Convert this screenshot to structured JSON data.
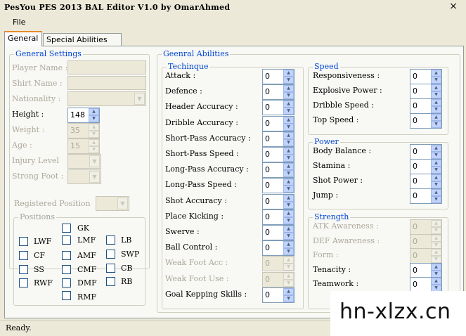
{
  "window": {
    "title": "PesYou PES 2013 BAL Editor V1.0 by OmarAhmed",
    "close_glyph": "×"
  },
  "menu": {
    "file": "File"
  },
  "tabs": [
    {
      "label": "General"
    },
    {
      "label": "Special Abilities"
    }
  ],
  "general_settings": {
    "legend": "General Settings",
    "player_name": {
      "label": "Player Name :",
      "value": ""
    },
    "shirt_name": {
      "label": "Shirt Name :",
      "value": ""
    },
    "nationality": {
      "label": "Nationality :",
      "value": ""
    },
    "height": {
      "label": "Height :",
      "value": "148"
    },
    "weight": {
      "label": "Weight :",
      "value": "35"
    },
    "age": {
      "label": "Age :",
      "value": "15"
    },
    "injury_level": {
      "label": "Injury Level",
      "value": ""
    },
    "strong_foot": {
      "label": "Strong Foot :",
      "value": ""
    },
    "registered_position": {
      "label": "Registered Position",
      "value": ""
    }
  },
  "positions": {
    "legend": "Positions",
    "items": [
      "GK",
      "LWF",
      "LMF",
      "LB",
      "CF",
      "AMF",
      "SWP",
      "SS",
      "CMF",
      "CB",
      "RWF",
      "DMF",
      "RB",
      "RMF"
    ]
  },
  "general_abilities": {
    "legend": "Geenral Abilities"
  },
  "technique": {
    "legend": "Techinque",
    "rows": [
      {
        "label": "Attack :",
        "value": "0"
      },
      {
        "label": "Defence :",
        "value": "0"
      },
      {
        "label": "Header Accuracy :",
        "value": "0"
      },
      {
        "label": "Dribble Accuracy :",
        "value": "0"
      },
      {
        "label": "Short-Pass Accuracy :",
        "value": "0"
      },
      {
        "label": "Short-Pass Speed :",
        "value": "0"
      },
      {
        "label": "Long-Pass Accuracy :",
        "value": "0"
      },
      {
        "label": "Long-Pass Speed :",
        "value": "0"
      },
      {
        "label": "Shot Accuracy :",
        "value": "0"
      },
      {
        "label": "Place Kicking :",
        "value": "0"
      },
      {
        "label": "Swerve :",
        "value": "0"
      },
      {
        "label": "Ball Control :",
        "value": "0"
      },
      {
        "label": "Weak Foot Acc :",
        "value": "0"
      },
      {
        "label": "Weak Foot Use :",
        "value": "0"
      },
      {
        "label": "Goal Kepping Skills :",
        "value": "0"
      }
    ]
  },
  "speed": {
    "legend": "Speed",
    "rows": [
      {
        "label": "Responsiveness :",
        "value": "0"
      },
      {
        "label": "Explosive Power :",
        "value": "0"
      },
      {
        "label": "Dribble Speed :",
        "value": "0"
      },
      {
        "label": "Top Speed :",
        "value": "0"
      }
    ]
  },
  "power": {
    "legend": "Power",
    "rows": [
      {
        "label": "Body Balance :",
        "value": "0"
      },
      {
        "label": "Stamina :",
        "value": "0"
      },
      {
        "label": "Shot Power :",
        "value": "0"
      },
      {
        "label": "Jump :",
        "value": "0"
      }
    ]
  },
  "strength": {
    "legend": "Strength",
    "rows": [
      {
        "label": "ATK Awareness :",
        "value": "0"
      },
      {
        "label": "DEF Awareness :",
        "value": "0"
      },
      {
        "label": "Form :",
        "value": "0"
      },
      {
        "label": "Tenacity :",
        "value": "0"
      },
      {
        "label": "Teamwork :",
        "value": "0"
      }
    ]
  },
  "status": {
    "text": "Ready."
  },
  "watermark": {
    "text": "hn-xlzx.cn"
  }
}
